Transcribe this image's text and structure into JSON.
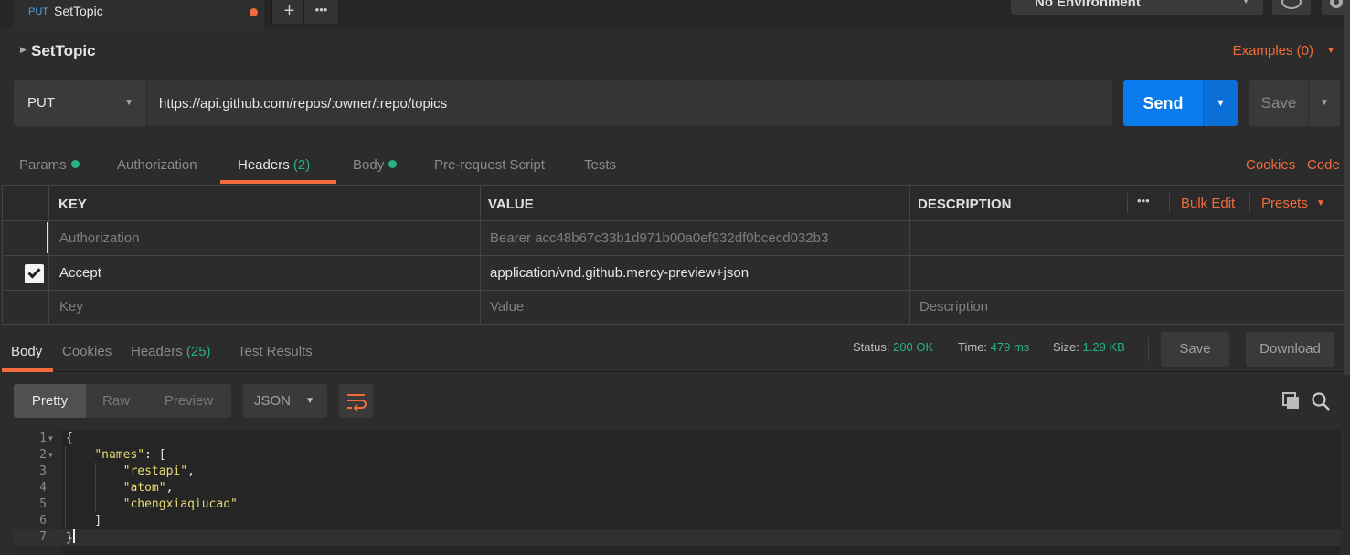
{
  "tabs": [
    {
      "method": "PUT",
      "name": "SetTopic",
      "unsaved": true
    }
  ],
  "tab_actions": {
    "new_tab": "+",
    "more": "•••"
  },
  "environment": {
    "selected": "No Environment"
  },
  "request": {
    "name": "SetTopic",
    "examples_label": "Examples (0)",
    "method": "PUT",
    "url": "https://api.github.com/repos/:owner/:repo/topics",
    "send_label": "Send",
    "save_label": "Save"
  },
  "request_tabs": [
    {
      "label": "Params",
      "dot": true
    },
    {
      "label": "Authorization"
    },
    {
      "label": "Headers",
      "count": "(2)",
      "active": true
    },
    {
      "label": "Body",
      "dot": true
    },
    {
      "label": "Pre-request Script"
    },
    {
      "label": "Tests"
    }
  ],
  "request_links": {
    "cookies": "Cookies",
    "code": "Code"
  },
  "headers_table": {
    "columns": {
      "key": "KEY",
      "value": "VALUE",
      "description": "DESCRIPTION"
    },
    "actions": {
      "more": "•••",
      "bulk_edit": "Bulk Edit",
      "presets": "Presets"
    },
    "rows": [
      {
        "enabled": false,
        "key": "Authorization",
        "value": "Bearer acc48b67c33b1d971b00a0ef932df0bcecd032b3",
        "description": ""
      },
      {
        "enabled": true,
        "key": "Accept",
        "value": "application/vnd.github.mercy-preview+json",
        "description": ""
      }
    ],
    "placeholders": {
      "key": "Key",
      "value": "Value",
      "description": "Description"
    }
  },
  "response": {
    "tabs": [
      {
        "label": "Body",
        "active": true
      },
      {
        "label": "Cookies"
      },
      {
        "label": "Headers",
        "count": "(25)"
      },
      {
        "label": "Test Results"
      }
    ],
    "status_label": "Status:",
    "status_value": "200 OK",
    "time_label": "Time:",
    "time_value": "479 ms",
    "size_label": "Size:",
    "size_value": "1.29 KB",
    "save_label": "Save",
    "download_label": "Download",
    "view_modes": [
      "Pretty",
      "Raw",
      "Preview"
    ],
    "format": "JSON",
    "code_lines": [
      {
        "n": "1",
        "text": "{",
        "fold": true
      },
      {
        "n": "2",
        "key": "\"names\"",
        "rest": ": [",
        "fold": true
      },
      {
        "n": "3",
        "str": "\"restapi\"",
        "rest": ","
      },
      {
        "n": "4",
        "str": "\"atom\"",
        "rest": ","
      },
      {
        "n": "5",
        "str": "\"chengxiaqiucao\"",
        "rest": ""
      },
      {
        "n": "6",
        "text": "]"
      },
      {
        "n": "7",
        "text": "}"
      }
    ]
  },
  "colors": {
    "accent": "#f26b3a",
    "send": "#097bed",
    "success": "#26b47f",
    "json_string": "#e6db74"
  }
}
